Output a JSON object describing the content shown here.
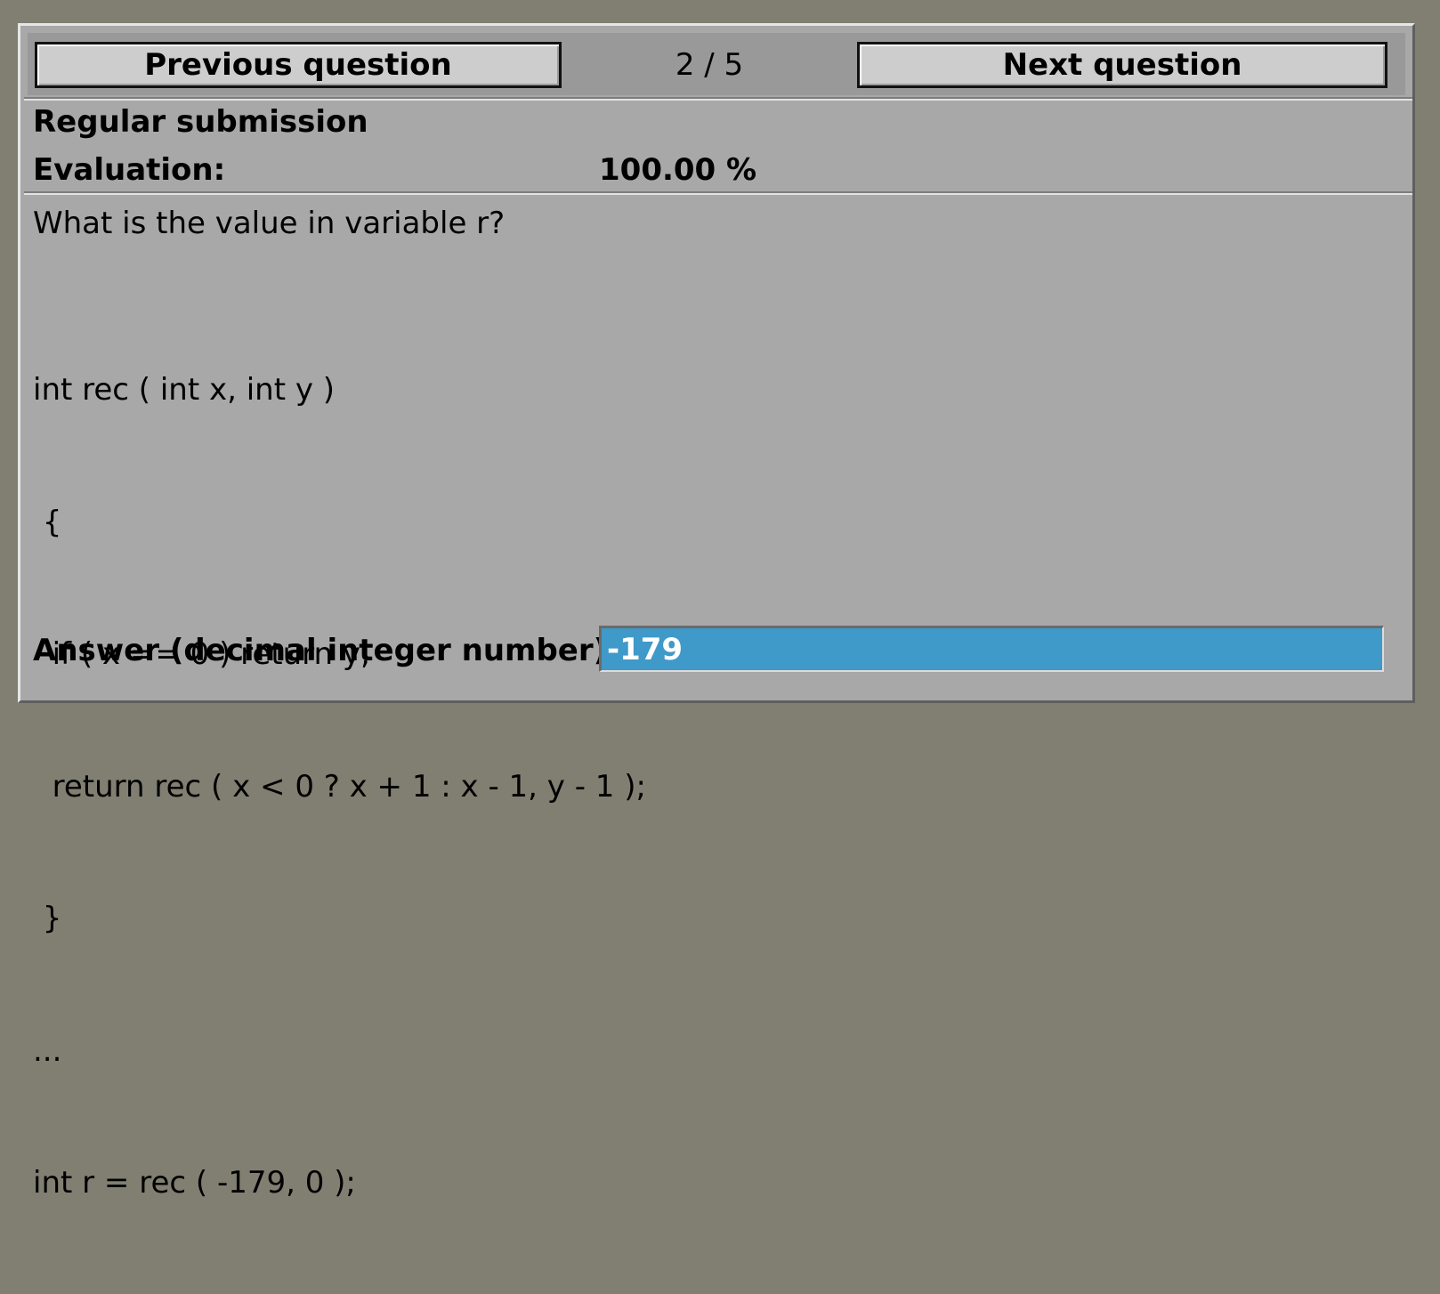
{
  "nav": {
    "prev_label": "Previous question",
    "counter": "2 / 5",
    "next_label": "Next question"
  },
  "submission": {
    "title": "Regular submission",
    "evaluation_label": "Evaluation:",
    "evaluation_value": "100.00 %"
  },
  "question": {
    "prompt": "What is the value in variable r?",
    "code_lines": [
      "int rec ( int x, int y )",
      " {",
      "  if ( x == 0 ) return y;",
      "  return rec ( x < 0 ? x + 1 : x - 1, y - 1 );",
      " }",
      "...",
      "int r = rec ( -179, 0 );"
    ]
  },
  "answer": {
    "label": "Answer (decimal integer number):",
    "value": "-179"
  },
  "colors": {
    "background": "#807f72",
    "panel": "#a8a8a8",
    "answer_highlight": "#3f99c9"
  }
}
